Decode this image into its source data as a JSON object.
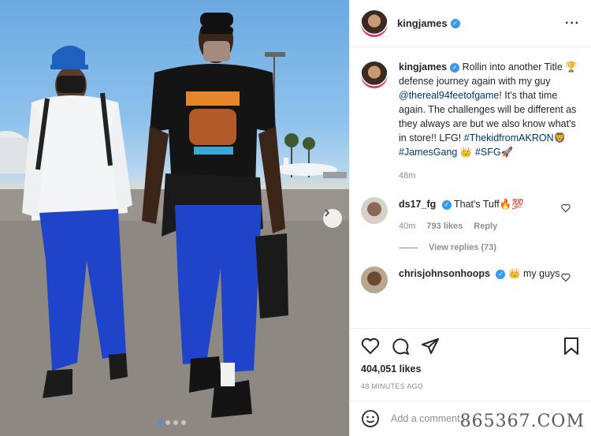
{
  "post": {
    "username": "kingjames",
    "more_icon": "more-dots-icon"
  },
  "caption": {
    "username": "kingjames",
    "text_1": "Rollin into another Title 🏆defense journey again with my guy ",
    "mention": "@thereal94feetofgame",
    "text_2": "! It's that time again. The challenges will be different as they always are but we also know what's in store!! LFG! ",
    "hashtag_1": "#ThekidfromAKRON",
    "emoji_1": "🦁",
    "hashtag_2": "#JamesGang",
    "emoji_2": "👑",
    "hashtag_3": "#SFG",
    "emoji_3": "🚀",
    "time": "48m"
  },
  "comments": [
    {
      "username": "ds17_fg",
      "text": "That's Tuff🔥💯",
      "time": "40m",
      "likes": "793 likes",
      "reply": "Reply",
      "view_replies": "View replies (73)"
    },
    {
      "username": "chrisjohnsonhoops",
      "text": "👑 my guys"
    }
  ],
  "actions": {
    "likes": "404,051 likes",
    "timestamp": "48 MINUTES AGO"
  },
  "add_comment": {
    "placeholder": "Add a comment..."
  },
  "watermark": "865367.COM",
  "colors": {
    "verified": "#3897f0",
    "link": "#00376b",
    "muted": "#8e8e8e"
  }
}
